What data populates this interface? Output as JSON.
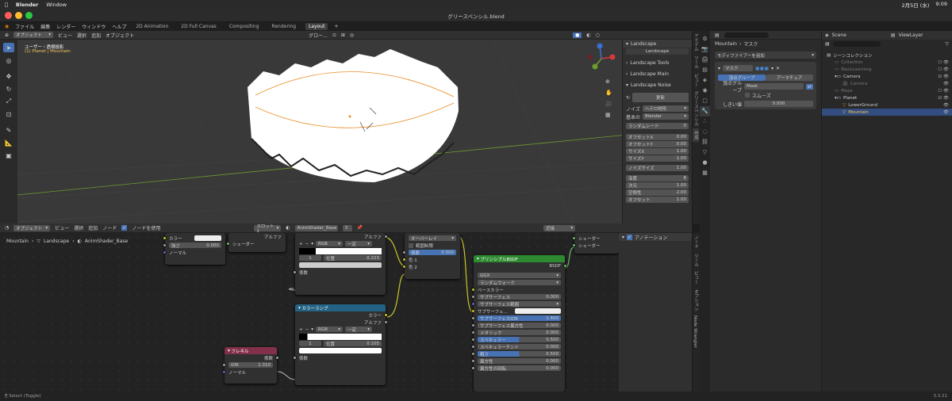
{
  "mac_menubar": {
    "app": "Blender",
    "window": "Window",
    "date": "2月5日 (水)",
    "time": "9:09"
  },
  "window_title": "グリースペンシル.blend",
  "menu": [
    "ファイル",
    "編集",
    "レンダー",
    "ウィンドウ",
    "ヘルプ"
  ],
  "workspaces": [
    "2D Animation",
    "2D Full Canvas",
    "Compositing",
    "Rendering",
    "Layout"
  ],
  "active_workspace": "Layout",
  "viewport": {
    "mode": "オブジェクト",
    "menus": [
      "ビュー",
      "選択",
      "追加",
      "オブジェクト"
    ],
    "orientation": "グロー...",
    "info_line1": "ユーザー・透視投影",
    "info_line2": "(1) Planet | Mountain"
  },
  "npanel": {
    "title": "Landscape",
    "preset_button": "Landscape",
    "sections": [
      "Landscape Tools",
      "Landscape Main",
      "Landscape Noise"
    ],
    "refresh": "更新",
    "noise_label": "ノイズ",
    "noise_value": "ヘテロ地形",
    "basis_label": "基本の",
    "basis_value": "Blender",
    "fields": [
      {
        "label": "ランダムシード",
        "value": "0"
      },
      {
        "label": "オフセットX",
        "value": "0.00"
      },
      {
        "label": "オフセットY",
        "value": "0.00"
      },
      {
        "label": "サイズX",
        "value": "1.00"
      },
      {
        "label": "サイズY",
        "value": "1.00"
      },
      {
        "label": "ノイズサイズ",
        "value": "1.00"
      },
      {
        "label": "深度",
        "value": "8"
      },
      {
        "label": "次元",
        "value": "1.00"
      },
      {
        "label": "空隙性",
        "value": "2.00"
      },
      {
        "label": "オフセット",
        "value": "1.00"
      }
    ],
    "tabs": [
      "アイテム",
      "ツール",
      "ビュー",
      "グリースペンシル",
      "作成"
    ]
  },
  "node_editor": {
    "mode": "オブジェクト",
    "menus": [
      "ビュー",
      "選択",
      "追加",
      "ノード"
    ],
    "use_nodes": "ノードを使用",
    "slot": "スロット1",
    "material": "AnimShader_Base",
    "users": "3",
    "breadcrumb": [
      "Mountain",
      "Landscape",
      "AnimShader_Base"
    ],
    "nodes": {
      "emission": {
        "color_label": "カラー",
        "strength_label": "強さ",
        "strength_value": "0.000",
        "normal_label": "ノーマル"
      },
      "shader_out": {
        "label": "シェーダー",
        "alpha": "アルファ"
      },
      "ramp1": {
        "alpha": "アルファ",
        "mode": "RGB",
        "interp": "一定",
        "index": "1",
        "pos_label": "位置",
        "pos_value": "0.223",
        "fac": "係数"
      },
      "ramp2": {
        "title": "カラーランプ",
        "color": "カラー",
        "alpha": "アルファ",
        "mode": "RGB",
        "interp": "一定",
        "index": "1",
        "pos_label": "位置",
        "pos_value": "0.105",
        "fac": "係数"
      },
      "fresnel": {
        "title": "フレネル",
        "fac": "係数",
        "ior_label": "IOR",
        "ior_value": "1.310",
        "normal": "ノーマル"
      },
      "mix": {
        "blend": "オーバーレイ",
        "clamp": "範囲制限",
        "fac_label": "係数",
        "fac_value": "0.500",
        "c1": "色 1",
        "c2": "色 2"
      },
      "principled": {
        "title": "プリンシプルBSDF",
        "bsdf": "BSDF",
        "dist": "GGX",
        "sss_method": "ランダムウォーク",
        "rows": [
          {
            "label": "ベースカラー",
            "value": ""
          },
          {
            "label": "サブサーフェス",
            "value": "0.000"
          },
          {
            "label": "サブサーフェス範囲",
            "value": ""
          },
          {
            "label": "サブサーフェ...",
            "value": ""
          },
          {
            "label": "サブサーフェスIOR",
            "value": "1.400"
          },
          {
            "label": "サブサーフェス異方性",
            "value": "0.000"
          },
          {
            "label": "メタリック",
            "value": "0.000"
          },
          {
            "label": "スペキュラー",
            "value": "0.500"
          },
          {
            "label": "スペキュラーチント",
            "value": "0.000"
          },
          {
            "label": "粗さ",
            "value": "0.500"
          },
          {
            "label": "異方性",
            "value": "0.000"
          },
          {
            "label": "異方性の回転",
            "value": "0.000"
          }
        ]
      },
      "output": {
        "surface": "シェーダー",
        "volume": "シェーダー"
      }
    },
    "right_mode": "近接",
    "annotation": "アノテーション",
    "tabs": [
      "ノード",
      "ツール",
      "ビュー",
      "オプション",
      "Node Wrangler"
    ]
  },
  "properties": {
    "object": "Mountain",
    "modifier": "マスク",
    "add_modifier": "モディファイアーを追加",
    "mod_name": "マスク",
    "tab_a": "頂点グループ",
    "tab_b": "アーマチュア",
    "vgroup_label": "頂点グループ",
    "vgroup_value": "Mask",
    "smooth": "スムーズ",
    "threshold_label": "しきい値",
    "threshold_value": "0.000"
  },
  "outliner": {
    "scene": "Scene",
    "view_layer": "ViewLayer",
    "items": [
      {
        "label": "シーンコレクション",
        "indent": 0
      },
      {
        "label": "Collection",
        "indent": 1
      },
      {
        "label": "BasicLearning",
        "indent": 1
      },
      {
        "label": "Camera",
        "indent": 1
      },
      {
        "label": "Camera",
        "indent": 2
      },
      {
        "label": "Maps",
        "indent": 1
      },
      {
        "label": "Planet",
        "indent": 1
      },
      {
        "label": "LowerGround",
        "indent": 2
      },
      {
        "label": "Mountain",
        "indent": 2
      }
    ]
  },
  "status": {
    "left": "Select (Toggle)",
    "version": "3.3.21"
  }
}
